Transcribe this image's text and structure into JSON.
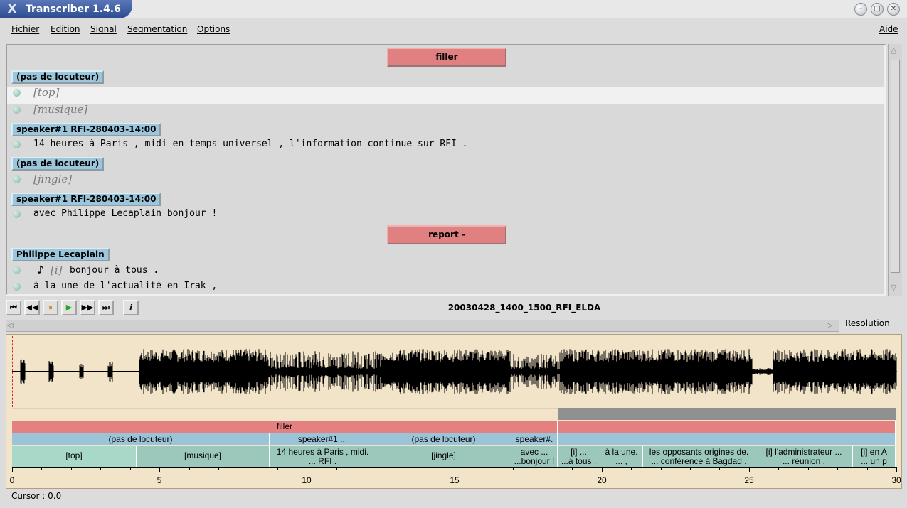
{
  "window": {
    "title": "Transcriber 1.4.6",
    "logo_glyph": "X"
  },
  "window_controls": {
    "minimize": "–",
    "maximize": "□",
    "close": "✕"
  },
  "menu": {
    "fichier": "Fichier",
    "edition": "Edition",
    "signal": "Signal",
    "segmentation": "Segmentation",
    "options": "Options",
    "aide": "Aide"
  },
  "transcript": {
    "section1": "filler",
    "speaker_none": "(pas de locuteur)",
    "speaker1": "speaker#1 RFI-280403-14:00",
    "event_top": "[top]",
    "event_musique": "[musique]",
    "line1": "14 heures à Paris , midi en temps universel , l'information continue sur RFI .",
    "event_jingle": "[jingle]",
    "line2": "avec Philippe Lecaplain bonjour !",
    "section2": "report -",
    "speaker2": "Philippe Lecaplain",
    "note_glyph": "♪",
    "event_i": "[i]",
    "line3": "bonjour à tous .",
    "line4": "à la une de l'actualité en Irak ,"
  },
  "player": {
    "file_name": "20030428_1400_1500_RFI_ELDA",
    "btn_first": "⏮",
    "btn_rew": "◀◀",
    "btn_pause": "⏸",
    "btn_play": "▶",
    "btn_fwd": "▶▶",
    "btn_last": "⏭",
    "btn_info": "i"
  },
  "resolution_label": "Resolution",
  "segments": {
    "section_filler": "filler",
    "spk_none_1": "(pas de locuteur)",
    "spk_1": "speaker#1 ...",
    "spk_none_2": "(pas de locuteur)",
    "spk_2": "speaker#.",
    "t_top": "[top]",
    "t_musique": "[musique]",
    "t_14h_a": "14 heures à Paris , midi.",
    "t_14h_b": "... RFI .",
    "t_jingle": "[jingle]",
    "t_avec_a": "avec ...",
    "t_avec_b": "...bonjour !",
    "t_i_a": "[i] ...",
    "t_i_b": "...à tous .",
    "t_une_a": "à la une.",
    "t_une_b": "... ,",
    "t_opp_a": "les opposants origines de.",
    "t_opp_b": "... conférence à Bagdad .",
    "t_admin_a": "[i] l'administrateur ...",
    "t_admin_b": "... réunion .",
    "t_last_a": "[i] en A",
    "t_last_b": "... un p"
  },
  "axis": {
    "min": 0,
    "max": 30,
    "labels": [
      "0",
      "5",
      "10",
      "15",
      "20",
      "25",
      "30"
    ]
  },
  "status": {
    "cursor": "Cursor : 0.0"
  },
  "colors": {
    "section": "#e48080",
    "speaker": "#9cc4d8",
    "segment": "#9cc8bc",
    "signal_bg": "#f2e4c8"
  }
}
